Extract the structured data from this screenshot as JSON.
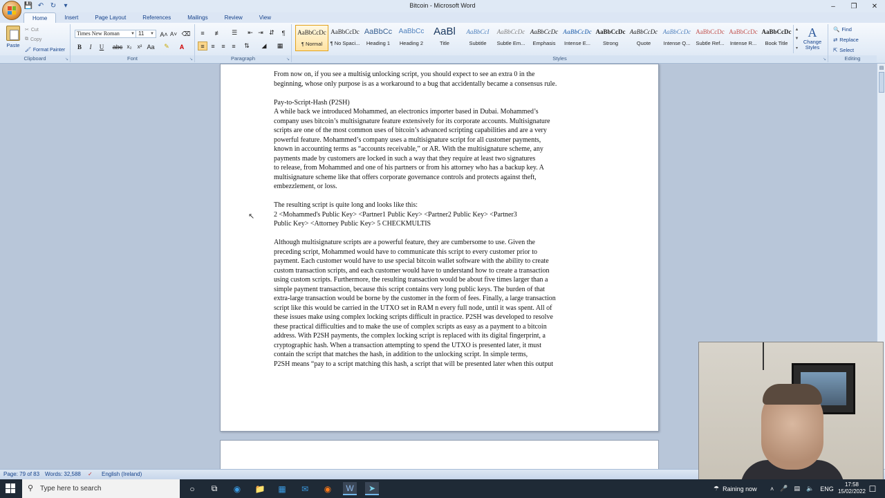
{
  "window": {
    "title": "Bitcoin - Microsoft Word",
    "minimize_icon": "minimize-icon",
    "restore_icon": "restore-icon",
    "close_icon": "close-icon"
  },
  "qat": [
    "save-icon",
    "undo-icon",
    "redo-icon",
    "customize-icon"
  ],
  "tabs": [
    {
      "label": "Home",
      "active": true
    },
    {
      "label": "Insert"
    },
    {
      "label": "Page Layout"
    },
    {
      "label": "References"
    },
    {
      "label": "Mailings"
    },
    {
      "label": "Review"
    },
    {
      "label": "View"
    }
  ],
  "ribbon": {
    "clipboard": {
      "paste": "Paste",
      "cut": "Cut",
      "copy": "Copy",
      "format_painter": "Format Painter",
      "label": "Clipboard"
    },
    "font": {
      "family": "Times New Roman",
      "size": "11",
      "label": "Font"
    },
    "paragraph": {
      "label": "Paragraph"
    },
    "styles": {
      "label": "Styles",
      "items": [
        {
          "preview": "AaBbCcDc",
          "name": "¶ Normal",
          "selected": true
        },
        {
          "preview": "AaBbCcDc",
          "name": "¶ No Spaci..."
        },
        {
          "preview": "AaBbCc",
          "name": "Heading 1"
        },
        {
          "preview": "AaBbCc",
          "name": "Heading 2"
        },
        {
          "preview": "AaBl",
          "name": "Title"
        },
        {
          "preview": "AaBbCcI",
          "name": "Subtitle"
        },
        {
          "preview": "AaBbCcDc",
          "name": "Subtle Em..."
        },
        {
          "preview": "AaBbCcDc",
          "name": "Emphasis"
        },
        {
          "preview": "AaBbCcDc",
          "name": "Intense E..."
        },
        {
          "preview": "AaBbCcDc",
          "name": "Strong"
        },
        {
          "preview": "AaBbCcDc",
          "name": "Quote"
        },
        {
          "preview": "AaBbCcDc",
          "name": "Intense Q..."
        },
        {
          "preview": "AaBbCcDc",
          "name": "Subtle Ref..."
        },
        {
          "preview": "AaBbCcDc",
          "name": "Intense R..."
        },
        {
          "preview": "AaBbCcDc",
          "name": "Book Title"
        }
      ],
      "change_styles": "Change Styles"
    },
    "editing": {
      "find": "Find",
      "replace": "Replace",
      "select": "Select",
      "label": "Editing"
    }
  },
  "document": {
    "lines": [
      "From now on, if you see a multisig unlocking script, you should expect to see an extra 0 in the",
      "beginning, whose only purpose is as a workaround to a bug that accidentally became a consensus rule.",
      "",
      "Pay-to-Script-Hash (P2SH)",
      "A while back we introduced Mohammed, an electronics importer based in Dubai. Mohammed’s",
      "company uses bitcoin’s multisignature feature extensively for its corporate accounts. Multisignature",
      "scripts are one of the most common uses of bitcoin’s advanced scripting capabilities and are a very",
      "powerful feature. Mohammed’s company uses a multisignature script for all customer payments,",
      "known in accounting terms as “accounts receivable,” or AR. With the multisignature scheme, any",
      "payments made by customers are locked in such a way that they require at least two signatures",
      "to release, from Mohammed and one of his partners or from his attorney who has a backup key. A",
      "multisignature scheme like that offers corporate governance controls and protects against theft,",
      "embezzlement, or loss.",
      "",
      "The resulting script is quite long and looks like this:",
      "2 <Mohammed's Public Key> <Partner1 Public Key> <Partner2 Public Key> <Partner3",
      "Public Key> <Attorney Public Key> 5 CHECKMULTIS",
      "",
      "Although multisignature scripts are a powerful feature, they are cumbersome to use. Given the",
      "preceding script, Mohammed would have to communicate this script to every customer prior to",
      "payment. Each customer would have to use special bitcoin wallet software with the ability to create",
      "custom transaction scripts, and each customer would have to understand how to create a transaction",
      "using custom scripts. Furthermore, the resulting transaction would be about five times larger than a",
      "simple payment transaction, because this script contains very long public keys. The burden of that",
      "extra-large transaction would be borne by the customer in the form of fees. Finally, a large transaction",
      "script like this would be carried in the UTXO set in RAM n every full node, until it was spent. All of",
      "these issues make using complex locking scripts difficult in practice. P2SH was developed to resolve",
      "these practical difficulties and to make the use of complex scripts as easy as a payment to a bitcoin",
      "address. With P2SH payments, the complex locking script is replaced with its digital fingerprint, a",
      "cryptographic hash. When a transaction attempting to spend the UTXO is presented later, it must",
      "contain the script that matches the hash, in addition to the unlocking script. In simple terms,",
      "P2SH means “pay to a script matching this hash, a script that will be presented later when this output"
    ]
  },
  "statusbar": {
    "page": "Page: 79 of 83",
    "words": "Words: 32,588",
    "language": "English (Ireland)"
  },
  "taskbar": {
    "search_placeholder": "Type here to search",
    "weather": "Raining now",
    "lang": "ENG",
    "time": "17:58",
    "date": "15/02/2022"
  }
}
